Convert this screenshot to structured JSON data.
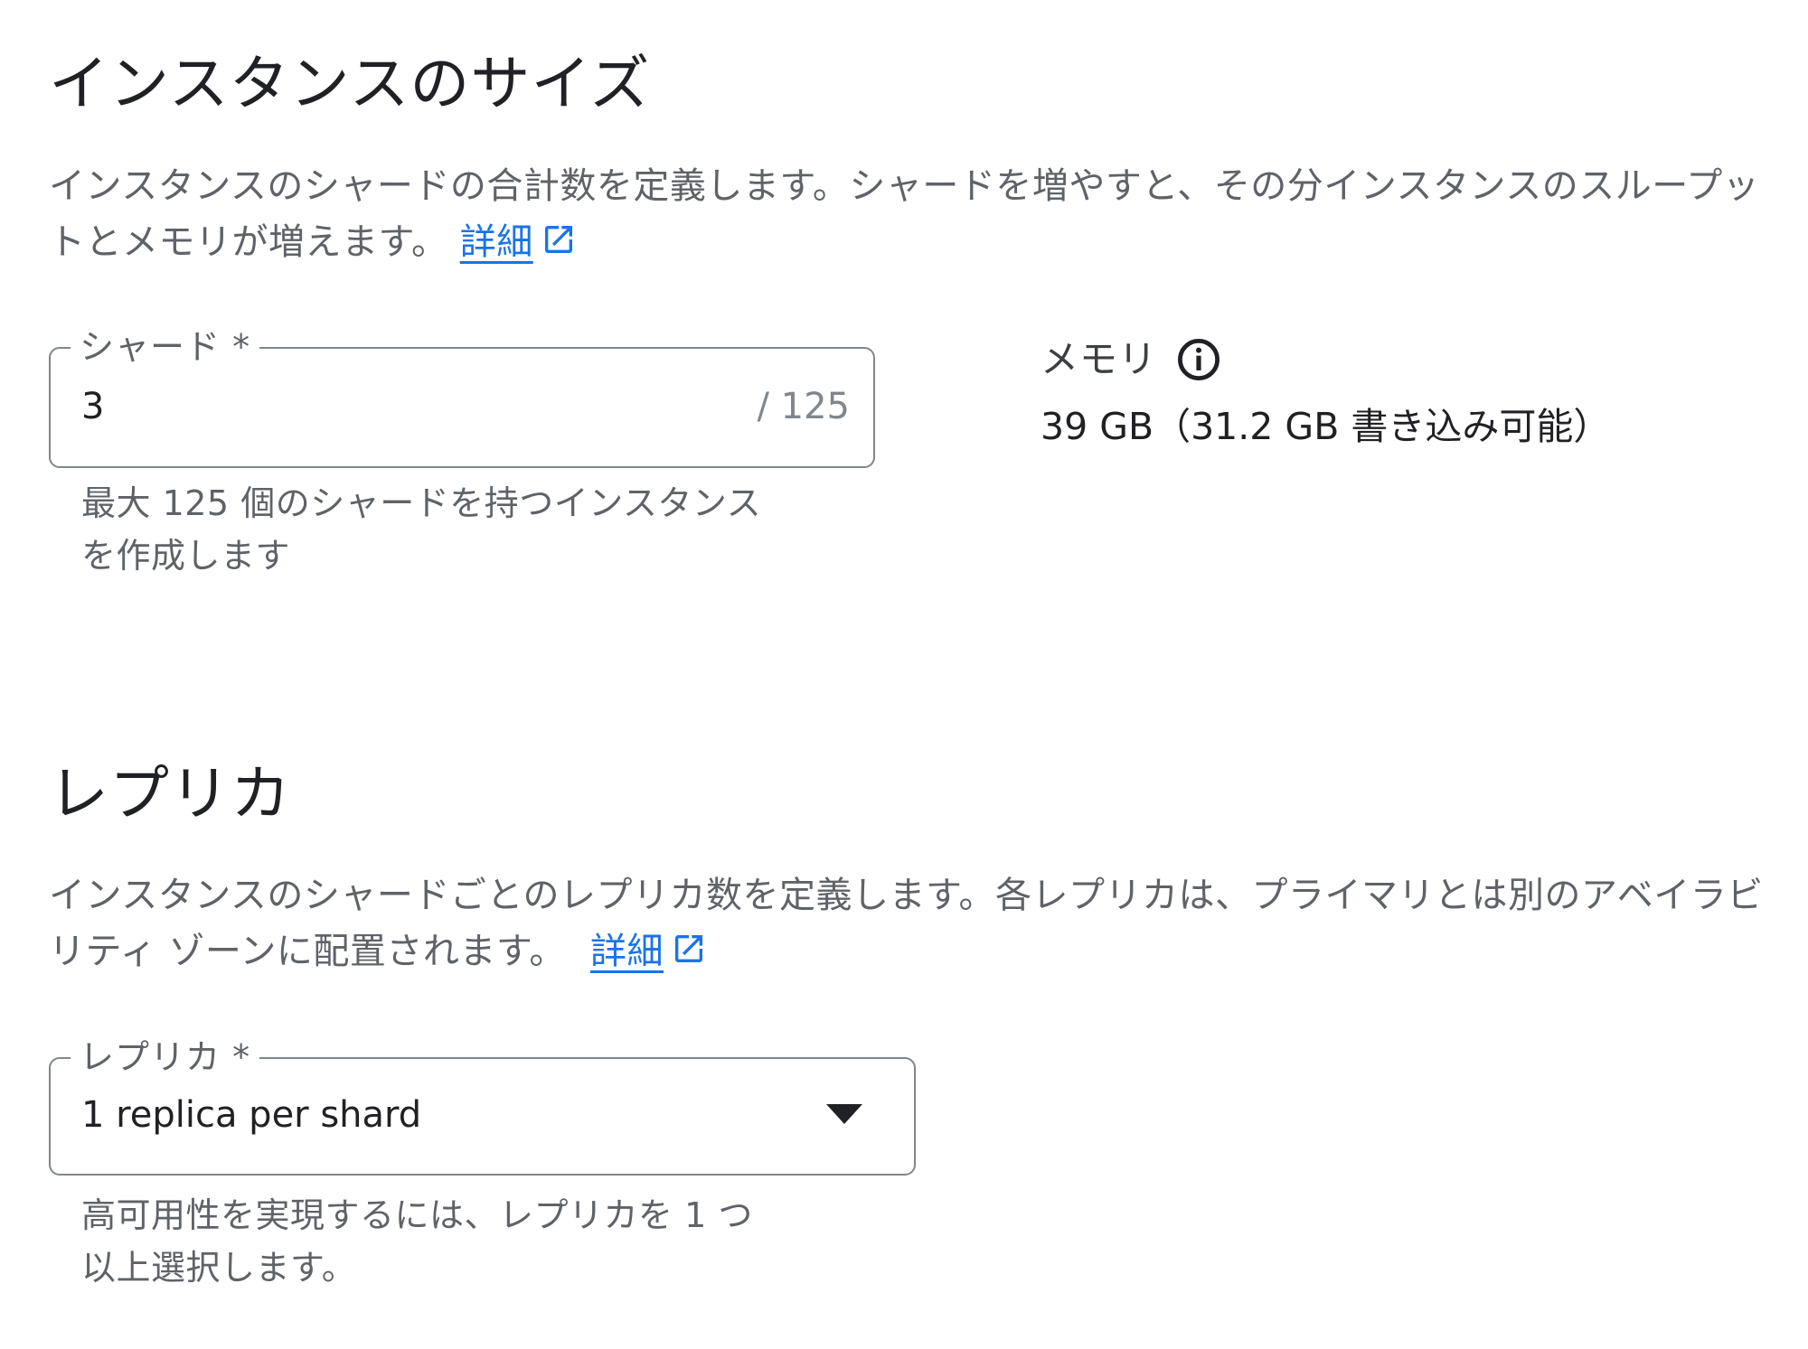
{
  "instance_size": {
    "title": "インスタンスのサイズ",
    "description": "インスタンスのシャードの合計数を定義します。シャードを増やすと、その分インスタンスのスループットとメモリが増えます。",
    "learn_more_label": "詳細",
    "shards_field": {
      "label": "シャード *",
      "value": "3",
      "counter": "/ 125",
      "helper_text": "最大 125 個のシャードを持つインスタンスを作成します"
    },
    "memory": {
      "label": "メモリ",
      "value": "39 GB（31.2 GB 書き込み可能）"
    }
  },
  "replicas": {
    "title": "レプリカ",
    "description": "インスタンスのシャードごとのレプリカ数を定義します。各レプリカは、プライマリとは別のアベイラビリティ ゾーンに配置されます。",
    "learn_more_label": "詳細",
    "replicas_field": {
      "label": "レプリカ *",
      "selected_value": "1 replica per shard",
      "helper_text": "高可用性を実現するには、レプリカを 1 つ以上選択します。"
    }
  },
  "colors": {
    "link": "#1a73e8",
    "text_primary": "#202124",
    "text_secondary": "#5f6368",
    "border": "#80868b"
  }
}
